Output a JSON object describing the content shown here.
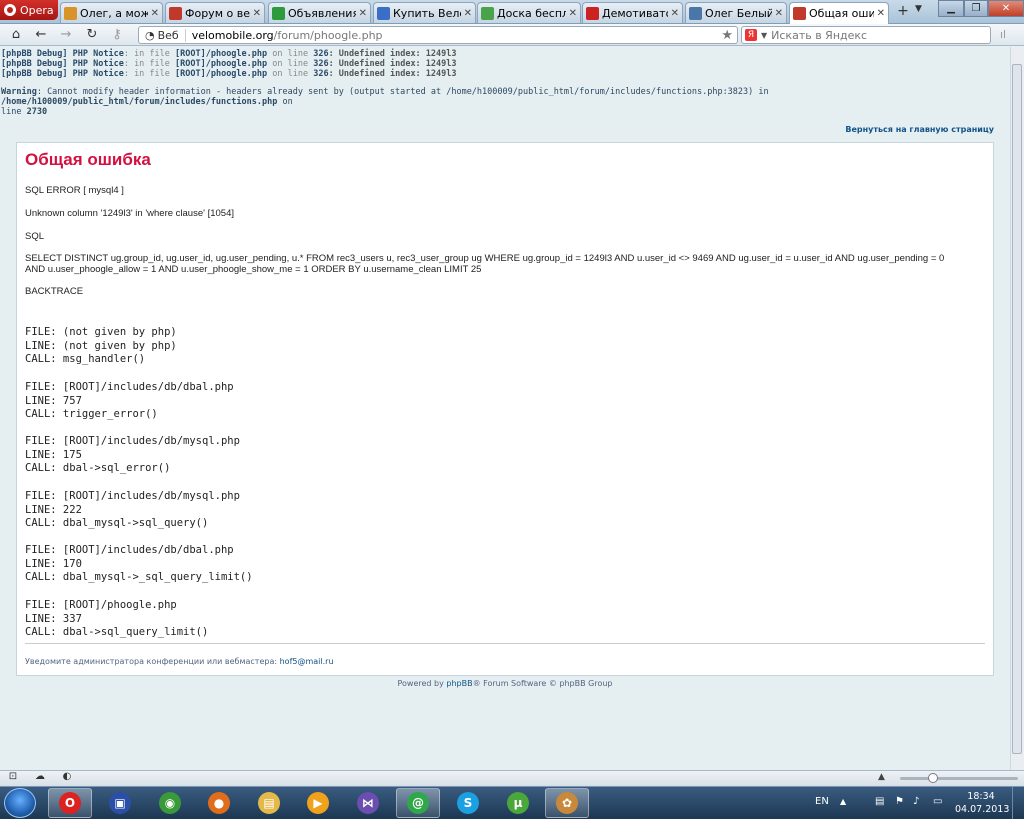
{
  "browser": {
    "opera_label": "Opera",
    "tabs": [
      {
        "label": "Олег, а может...",
        "fav": "#d9932b"
      },
      {
        "label": "Форум о вело...",
        "fav": "#c0392b"
      },
      {
        "label": "Объявления •...",
        "fav": "#2e9a3e"
      },
      {
        "label": "Купить Велос...",
        "fav": "#3a6fc7"
      },
      {
        "label": "Доска беспла...",
        "fav": "#4aa34a"
      },
      {
        "label": "Демотиватор...",
        "fav": "#cc2222"
      },
      {
        "label": "Олег Белый",
        "fav": "#4a76a8"
      },
      {
        "label": "Общая ошибка",
        "fav": "#c0392b"
      }
    ],
    "new_tab": "+",
    "web_label": "Веб",
    "url_host": "velomobile.org",
    "url_path": "/forum/phoogle.php",
    "search_placeholder": "Искать в Яндекс",
    "search_logo": "Я"
  },
  "debug_notices": [
    {
      "label": "[phpBB Debug] PHP Notice",
      "mid1": ": in file ",
      "file": "[ROOT]/phoogle.php",
      "mid2": " on line ",
      "line": "326",
      "msg": ": Undefined index: 1249l3"
    },
    {
      "label": "[phpBB Debug] PHP Notice",
      "mid1": ": in file ",
      "file": "[ROOT]/phoogle.php",
      "mid2": " on line ",
      "line": "326",
      "msg": ": Undefined index: 1249l3"
    },
    {
      "label": "[phpBB Debug] PHP Notice",
      "mid1": ": in file ",
      "file": "[ROOT]/phoogle.php",
      "mid2": " on line ",
      "line": "326",
      "msg": ": Undefined index: 1249l3"
    }
  ],
  "warning": {
    "label": "Warning",
    "text": ": Cannot modify header information - headers already sent by (output started at /home/h100009/public_html/forum/includes/functions.php:3823) in ",
    "path": "/home/h100009/public_html/forum/includes/functions.php",
    "on": " on",
    "line_prefix": "line ",
    "line": "2730"
  },
  "back_link": "Вернуться на главную страницу",
  "error": {
    "title": "Общая ошибка",
    "sql_error": "SQL ERROR [ mysql4 ]",
    "unknown_column": "Unknown column '1249l3' in 'where clause' [1054]",
    "sql_label": "SQL",
    "query_line1": "SELECT DISTINCT ug.group_id, ug.user_id, ug.user_pending, u.* FROM rec3_users u, rec3_user_group ug WHERE ug.group_id = 1249l3 AND u.user_id <> 9469 AND ug.user_id = u.user_id AND ug.user_pending = 0",
    "query_line2": "AND u.user_phoogle_allow = 1 AND u.user_phoogle_show_me = 1 ORDER BY u.username_clean LIMIT 25",
    "backtrace_label": "BACKTRACE",
    "backtrace": [
      {
        "file": "FILE: (not given by php)",
        "line": "LINE: (not given by php)",
        "call": "CALL: msg_handler()"
      },
      {
        "file": "FILE: [ROOT]/includes/db/dbal.php",
        "line": "LINE: 757",
        "call": "CALL: trigger_error()"
      },
      {
        "file": "FILE: [ROOT]/includes/db/mysql.php",
        "line": "LINE: 175",
        "call": "CALL: dbal->sql_error()"
      },
      {
        "file": "FILE: [ROOT]/includes/db/mysql.php",
        "line": "LINE: 222",
        "call": "CALL: dbal_mysql->sql_query()"
      },
      {
        "file": "FILE: [ROOT]/includes/db/dbal.php",
        "line": "LINE: 170",
        "call": "CALL: dbal_mysql->_sql_query_limit()"
      },
      {
        "file": "FILE: [ROOT]/phoogle.php",
        "line": "LINE: 337",
        "call": "CALL: dbal->sql_query_limit()"
      }
    ],
    "footnote_text": "Уведомите администратора конференции или вебмастера: ",
    "footnote_email": "hof5@mail.ru"
  },
  "powered": {
    "prefix": "Powered by ",
    "link": "phpBB",
    "suffix": "® Forum Software © phpBB Group"
  },
  "taskbar": {
    "lang": "EN",
    "time": "18:34",
    "date": "04.07.2013",
    "apps": [
      {
        "name": "opera",
        "color": "#d22",
        "glyph": "O",
        "active": true
      },
      {
        "name": "save",
        "color": "#2a4fa8",
        "glyph": "▣",
        "active": false
      },
      {
        "name": "chrome",
        "color": "#3a9a3a",
        "glyph": "◉",
        "active": false
      },
      {
        "name": "firefox",
        "color": "#e06d1b",
        "glyph": "●",
        "active": false
      },
      {
        "name": "explorer",
        "color": "#e3b94a",
        "glyph": "▤",
        "active": false
      },
      {
        "name": "media",
        "color": "#f0a21a",
        "glyph": "▶",
        "active": false
      },
      {
        "name": "vs",
        "color": "#6a4fb0",
        "glyph": "⋈",
        "active": false
      },
      {
        "name": "mail",
        "color": "#2fa84a",
        "glyph": "@",
        "active": true
      },
      {
        "name": "skype",
        "color": "#1ba0e2",
        "glyph": "S",
        "active": false
      },
      {
        "name": "utorrent",
        "color": "#4aa83a",
        "glyph": "µ",
        "active": false
      },
      {
        "name": "paint",
        "color": "#c9893a",
        "glyph": "✿",
        "active": true
      }
    ]
  }
}
